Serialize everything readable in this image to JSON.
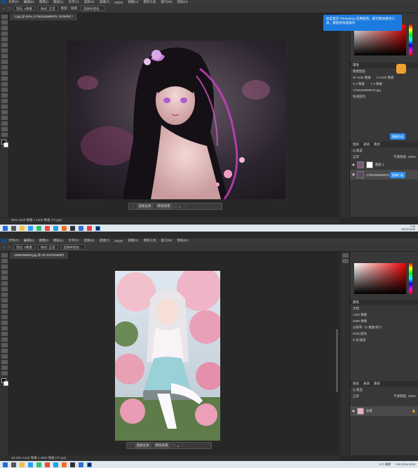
{
  "top": {
    "menu": [
      "文件(F)",
      "编辑(E)",
      "图像(I)",
      "图层(L)",
      "文字(Y)",
      "选择(S)",
      "滤镜(T)",
      "3D(D)",
      "视图(V)",
      "增效工具",
      "窗口(W)",
      "帮助(H)"
    ],
    "options": {
      "feather": "羽化: 0像素",
      "style": "样式: 正常",
      "width": "宽度:",
      "height": "高度:",
      "select_subject": "选择并遮住..."
    },
    "doc_tab": "1.jpg @ 50% (1706150686875, RGB/8#) *",
    "status": "50% 1920 像素 x 1200 像素 (72 ppi)",
    "ctx": {
      "select_subject": "选择主体",
      "remove_bg": "移除背景"
    },
    "tooltip": "您是首次 Photoshop 应用程序。即可更加搜寻工具，教程和快速操作",
    "properties": {
      "title": "属性",
      "layer_label": "像素图层",
      "w": "W 1460 像素",
      "h": "H 1200 像素",
      "x": "X 0 像素",
      "y": "Y 0 像素",
      "file": "1706150686875.jpg",
      "quick": "快速操作"
    },
    "side_btn1": "图像生成",
    "side_btn2": "图像扩展",
    "layers": {
      "tabs": [
        "图层",
        "通道",
        "路径"
      ],
      "kind": "Q 类型",
      "mode": "正常",
      "opacity": "不透明度: 100%",
      "fill": "填充: 100%",
      "row1": "图层 1",
      "row2": "1706150686875"
    },
    "clock": {
      "time": "7:53",
      "date": "2024/12/05"
    }
  },
  "bottom": {
    "menu": [
      "文件(F)",
      "编辑(E)",
      "图像(I)",
      "图层(L)",
      "文字(Y)",
      "选择(S)",
      "滤镜(T)",
      "3D(D)",
      "视图(V)",
      "增效工具",
      "窗口(W)",
      "帮助(H)"
    ],
    "options": {
      "feather": "羽化: 0像素",
      "style": "样式: 正常",
      "select_subject": "选择并遮住..."
    },
    "doc_tab": "1605268849.jpg @ 33.3%(RGB/8#)",
    "status": "33.33% 1440 像素 x 2560 像素 (72 ppi)",
    "ctx": {
      "select_subject": "选择主体",
      "remove_bg": "移除背景"
    },
    "properties": {
      "title": "属性",
      "layer_label": "文档",
      "w": "1440 像素",
      "h": "2560 像素",
      "res": "分辨率: 72 像素/英寸",
      "mode": "RGB 颜色",
      "depth": "8 位/通道"
    },
    "layers": {
      "tabs": [
        "图层",
        "通道",
        "路径"
      ],
      "kind": "Q 类型",
      "mode": "正常",
      "opacity": "不透明度: 100%",
      "row1": "背景"
    },
    "tray": {
      "temp": "6°C 晴朗",
      "time": "7:56",
      "date": "2024/12/05"
    }
  }
}
